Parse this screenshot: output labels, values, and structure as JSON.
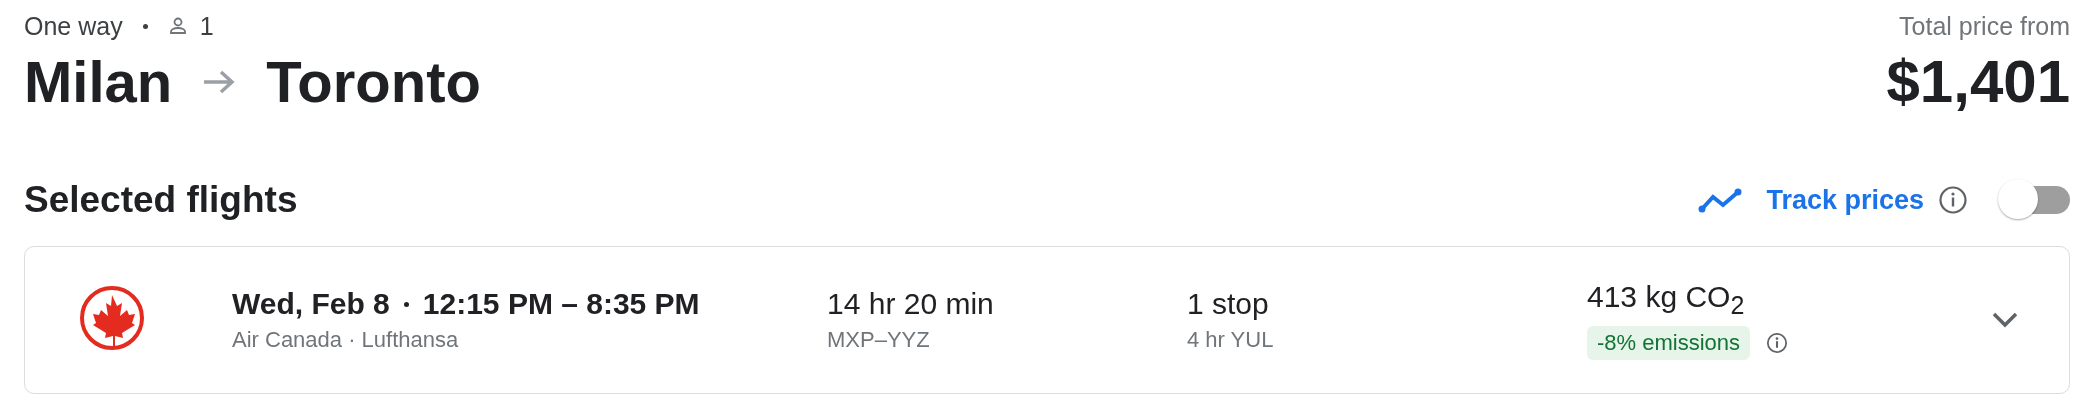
{
  "trip": {
    "type": "One way",
    "passengers": "1"
  },
  "route": {
    "from": "Milan",
    "to": "Toronto"
  },
  "price": {
    "label": "Total price from",
    "amount": "$1,401"
  },
  "section_title": "Selected flights",
  "track_prices": {
    "label": "Track prices",
    "on": false
  },
  "flight": {
    "date": "Wed, Feb 8",
    "times": "12:15 PM – 8:35 PM",
    "airlines": "Air Canada · Lufthansa",
    "duration": "14 hr 20 min",
    "airports": "MXP–YYZ",
    "stops": "1 stop",
    "layover": "4 hr YUL",
    "emissions": "413 kg CO$_{2}$",
    "emissions_badge": "-8% emissions",
    "expanded": false
  }
}
